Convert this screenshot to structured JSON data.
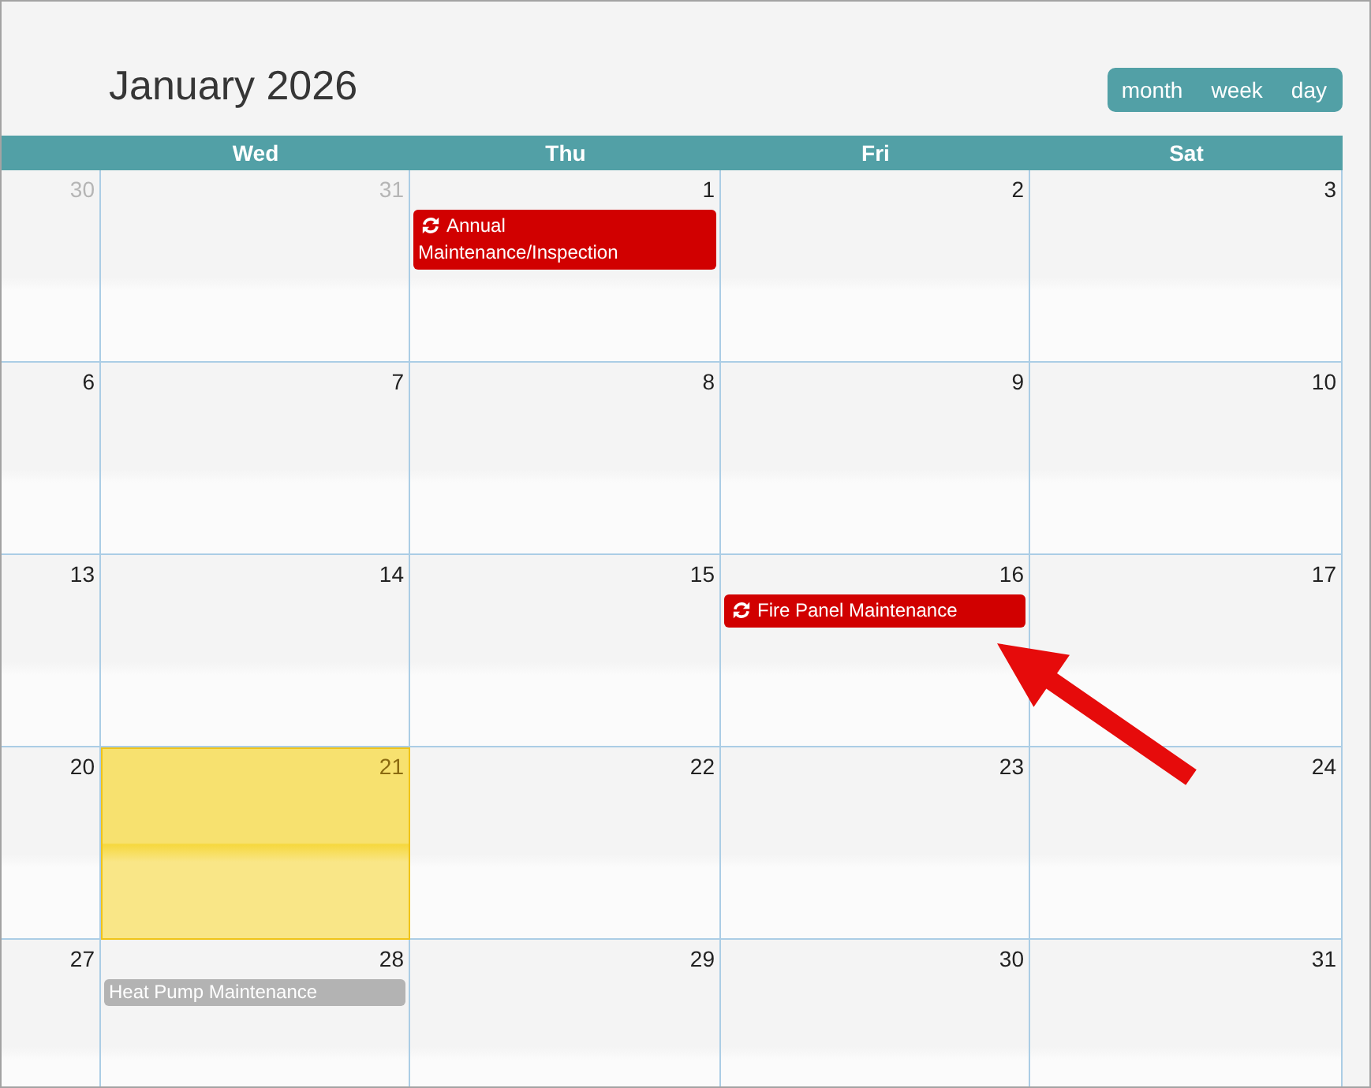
{
  "calendar": {
    "title": "January 2026",
    "view_buttons": [
      {
        "label": "month"
      },
      {
        "label": "week"
      },
      {
        "label": "day"
      }
    ]
  },
  "columns": [
    {
      "kind": "partial"
    },
    {
      "kind": "weekday",
      "label": "Wed"
    },
    {
      "kind": "weekday",
      "label": "Thu"
    },
    {
      "kind": "weekday",
      "label": "Fri"
    },
    {
      "kind": "weekday",
      "label": "Sat"
    }
  ],
  "weeks": [
    {
      "days": [
        {
          "day": "30",
          "other_month": true,
          "today": false
        },
        {
          "day": "31",
          "other_month": true,
          "today": false
        },
        {
          "day": "1",
          "other_month": false,
          "today": false,
          "events": [
            {
              "title": "Annual Maintenance/Inspection",
              "recurring": true,
              "color": "#d10000"
            }
          ]
        },
        {
          "day": "2",
          "other_month": false,
          "today": false
        },
        {
          "day": "3",
          "other_month": false,
          "today": false
        }
      ]
    },
    {
      "days": [
        {
          "day": "6",
          "other_month": false,
          "today": false
        },
        {
          "day": "7",
          "other_month": false,
          "today": false
        },
        {
          "day": "8",
          "other_month": false,
          "today": false
        },
        {
          "day": "9",
          "other_month": false,
          "today": false
        },
        {
          "day": "10",
          "other_month": false,
          "today": false
        }
      ]
    },
    {
      "days": [
        {
          "day": "13",
          "other_month": false,
          "today": false
        },
        {
          "day": "14",
          "other_month": false,
          "today": false
        },
        {
          "day": "15",
          "other_month": false,
          "today": false
        },
        {
          "day": "16",
          "other_month": false,
          "today": false,
          "events": [
            {
              "title": "Fire Panel Maintenance",
              "recurring": true,
              "color": "#d10000"
            }
          ]
        },
        {
          "day": "17",
          "other_month": false,
          "today": false
        }
      ]
    },
    {
      "days": [
        {
          "day": "20",
          "other_month": false,
          "today": false
        },
        {
          "day": "21",
          "other_month": false,
          "today": true
        },
        {
          "day": "22",
          "other_month": false,
          "today": false
        },
        {
          "day": "23",
          "other_month": false,
          "today": false
        },
        {
          "day": "24",
          "other_month": false,
          "today": false
        }
      ]
    },
    {
      "days": [
        {
          "day": "27",
          "other_month": false,
          "today": false
        },
        {
          "day": "28",
          "other_month": false,
          "today": false,
          "events": [
            {
              "title": "Heat Pump Maintenance",
              "recurring": false,
              "color": "#b3b3b3"
            }
          ]
        },
        {
          "day": "29",
          "other_month": false,
          "today": false
        },
        {
          "day": "30",
          "other_month": false,
          "today": false
        },
        {
          "day": "31",
          "other_month": false,
          "today": false
        }
      ]
    }
  ],
  "annotations": [
    {
      "kind": "arrow"
    }
  ]
}
